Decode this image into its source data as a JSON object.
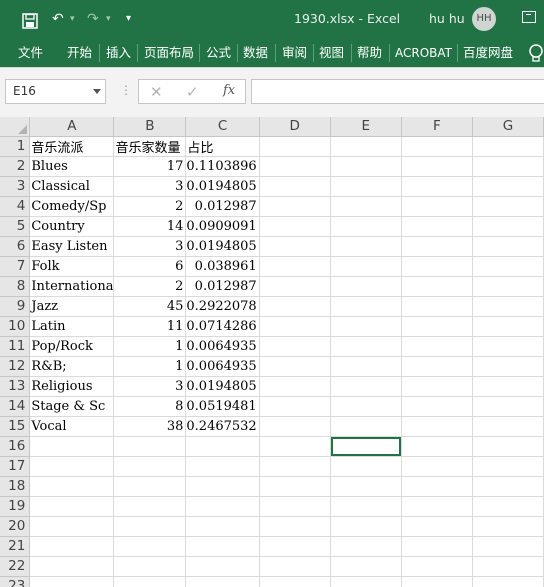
{
  "titlebar": {
    "save_icon": "save-icon",
    "undo_icon": "undo-icon",
    "redo_icon": "redo-icon",
    "customize_icon": "customize-quick-access-icon",
    "file_title": "1930.xlsx  -  Excel",
    "user_name": "hu hu",
    "avatar_initials": "HH",
    "colors": {
      "background": "#217346"
    }
  },
  "ribbon": {
    "tabs": [
      "文件",
      "开始",
      "插入",
      "页面布局",
      "公式",
      "数据",
      "审阅",
      "视图",
      "帮助",
      "ACROBAT",
      "百度网盘"
    ],
    "tell_me_icon": "lightbulb-icon"
  },
  "formula_bar": {
    "name_box": "E16",
    "cancel_icon": "✕",
    "enter_icon": "✓",
    "fx_label": "fx",
    "formula_value": ""
  },
  "sheet": {
    "column_headers": [
      "A",
      "B",
      "C",
      "D",
      "E",
      "F",
      "G"
    ],
    "row_headers": [
      "1",
      "2",
      "3",
      "4",
      "5",
      "6",
      "7",
      "8",
      "9",
      "10",
      "11",
      "12",
      "13",
      "14",
      "15",
      "16",
      "17",
      "18",
      "19",
      "20",
      "21",
      "22",
      "23"
    ],
    "header_row": [
      "音乐流派",
      "音乐家数量",
      "占比"
    ],
    "rows": [
      {
        "genre": "Blues",
        "count": "17",
        "share": "0.1103896"
      },
      {
        "genre": "Classical",
        "count": "3",
        "share": "0.0194805"
      },
      {
        "genre": "Comedy/Sp",
        "count": "2",
        "share": "0.012987"
      },
      {
        "genre": "Country",
        "count": "14",
        "share": "0.0909091"
      },
      {
        "genre": "Easy Listen",
        "count": "3",
        "share": "0.0194805"
      },
      {
        "genre": "Folk",
        "count": "6",
        "share": "0.038961"
      },
      {
        "genre": "Internationa",
        "count": "2",
        "share": "0.012987"
      },
      {
        "genre": "Jazz",
        "count": "45",
        "share": "0.2922078"
      },
      {
        "genre": "Latin",
        "count": "11",
        "share": "0.0714286"
      },
      {
        "genre": "Pop/Rock",
        "count": "1",
        "share": "0.0064935"
      },
      {
        "genre": "R&B;",
        "count": "1",
        "share": "0.0064935"
      },
      {
        "genre": "Religious",
        "count": "3",
        "share": "0.0194805"
      },
      {
        "genre": "Stage & Sc",
        "count": "8",
        "share": "0.0519481"
      },
      {
        "genre": "Vocal",
        "count": "38",
        "share": "0.2467532"
      }
    ],
    "selected_cell": "E16",
    "colors": {
      "selection": "#217346",
      "header_bg": "#e6e6e6",
      "gridline": "#dadada"
    }
  }
}
